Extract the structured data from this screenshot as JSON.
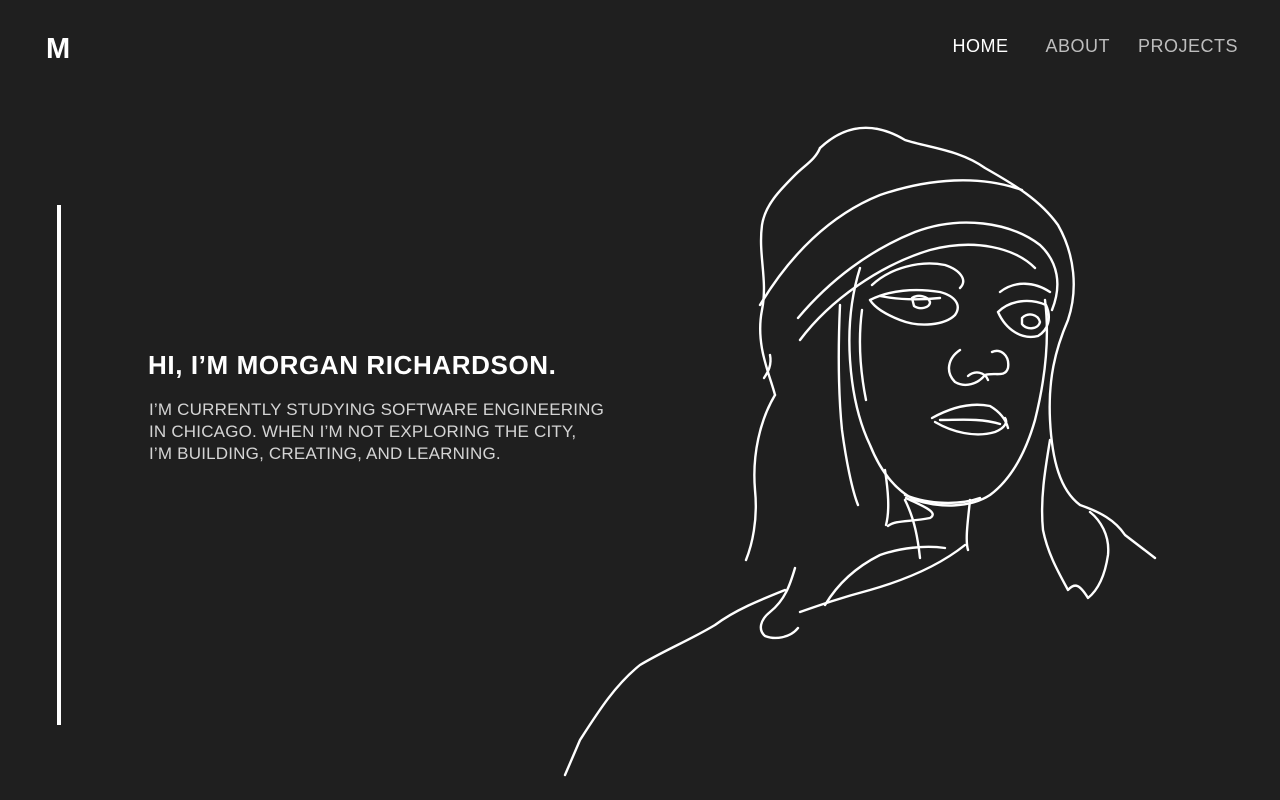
{
  "logo": {
    "text": "M"
  },
  "nav": {
    "items": [
      {
        "label": "HOME",
        "active": true
      },
      {
        "label": "ABOUT",
        "active": false
      },
      {
        "label": "PROJECTS",
        "active": false
      }
    ]
  },
  "hero": {
    "title": "HI, I’M MORGAN RICHARDSON.",
    "lines": [
      "I’M CURRENTLY STUDYING SOFTWARE ENGINEERING",
      "IN CHICAGO. WHEN I’M NOT EXPLORING THE CITY,",
      "I’M BUILDING, CREATING, AND LEARNING."
    ]
  },
  "illustration": {
    "subject": "line-art-portrait"
  },
  "colors": {
    "background": "#1f1f1f",
    "text": "#ffffff",
    "nav_inactive": "#bdbdbd",
    "accent_bar": "#ffffff"
  }
}
